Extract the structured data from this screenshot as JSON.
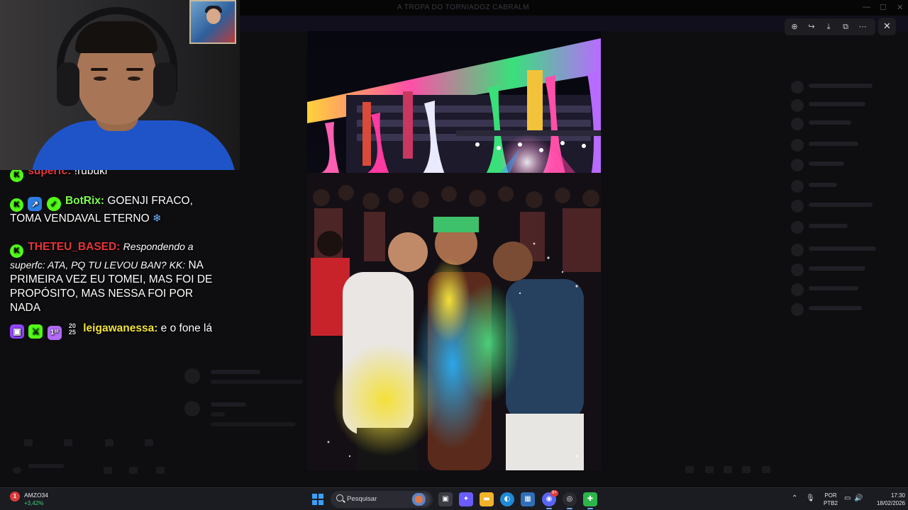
{
  "window": {
    "title": "A TROPA DO TORNIADOZ CABRALM",
    "controls": {
      "minimize": "—",
      "maximize": "☐",
      "close": "✕"
    }
  },
  "stream_chat": {
    "messages": [
      {
        "username": "superfc:",
        "user_color": "#e8353b",
        "text": "!rubuki",
        "badges": [
          "kick"
        ]
      },
      {
        "username": "BotRix:",
        "user_color": "#7dff4e",
        "text": "GOENJI FRACO, TOMA VENDAVAL ETERNO",
        "emoji": "❄",
        "badges": [
          "kick",
          "vip",
          "verified"
        ]
      },
      {
        "username": "THETEU_BASED:",
        "user_color": "#e8353b",
        "reply_prefix": "Respondendo a superfc: ATA, PQ TU LEVOU BAN? KK:",
        "text": "NA PRIMEIRA VEZ EU TOMEI, MAS FOI DE PROPÓSITO, MAS NESSA FOI POR NADA",
        "badges": [
          "kick"
        ]
      },
      {
        "username": "leigawanessa:",
        "user_color": "#f2e23a",
        "text": "e o fone lá",
        "badges": [
          "twitch",
          "sword",
          "first",
          "year"
        ],
        "year_badge": "20\n25"
      }
    ]
  },
  "image_viewer": {
    "toolbar": [
      {
        "name": "zoom-in",
        "glyph": "⊕"
      },
      {
        "name": "share",
        "glyph": "↪"
      },
      {
        "name": "download",
        "glyph": "⤓"
      },
      {
        "name": "open-external",
        "glyph": "⧉"
      },
      {
        "name": "more",
        "glyph": "⋯"
      }
    ],
    "close_glyph": "✕",
    "palette": {
      "sky": "#0a0a18",
      "building_colors": [
        "#ff3aa0",
        "#ffd23a",
        "#39e07a",
        "#3aa0ff",
        "#b86bff"
      ],
      "smoke": [
        "#f4e03a",
        "#2aa8e8",
        "#49d07a"
      ]
    }
  },
  "taskbar": {
    "stock": {
      "badge": "1",
      "name": "AMZO34",
      "change": "+3,42%",
      "change_color": "#3fd07a"
    },
    "search_placeholder": "Pesquisar",
    "apps": [
      {
        "name": "task-view",
        "glyph": "▣",
        "bg": "#3a3b44"
      },
      {
        "name": "copilot",
        "glyph": "✦",
        "bg": "#6a5cff"
      },
      {
        "name": "file-explorer",
        "glyph": "▬",
        "bg": "#f2b32a"
      },
      {
        "name": "edge",
        "glyph": "◐",
        "bg": "#1f8ad6"
      },
      {
        "name": "photos",
        "glyph": "▦",
        "bg": "#2f6fb5"
      },
      {
        "name": "discord",
        "glyph": "◉",
        "bg": "#5865f2",
        "badge": "9+"
      },
      {
        "name": "obs",
        "glyph": "◎",
        "bg": "#2a2a30"
      },
      {
        "name": "whatsapp-app",
        "glyph": "✚",
        "bg": "#2cb64a"
      }
    ],
    "tray": {
      "chevron": "⌃",
      "mic": "🎙",
      "lang_top": "POR",
      "lang_bottom": "PTB2",
      "monitor": "▭",
      "volume": "🔊",
      "time": "17:30",
      "date": "18/02/2026"
    }
  }
}
